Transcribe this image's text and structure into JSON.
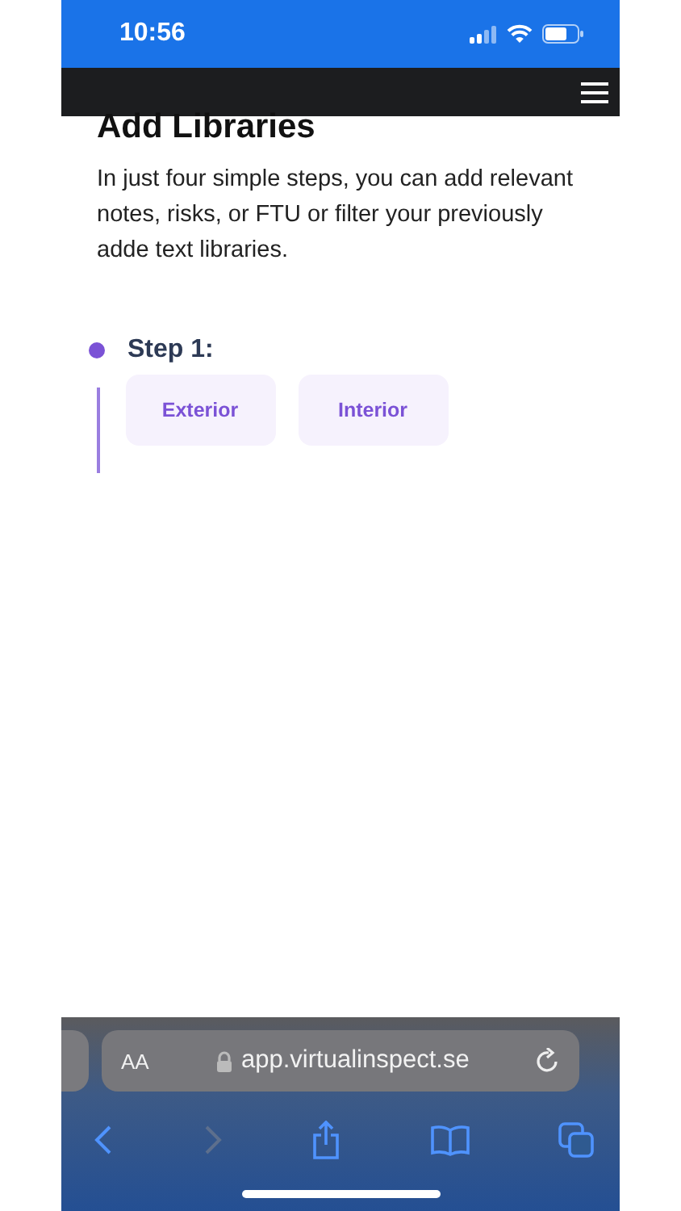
{
  "status_bar": {
    "time": "10:56"
  },
  "page": {
    "title": "Add Libraries",
    "intro": "In just four simple steps, you can add relevant notes, risks, or FTU or filter your previously adde text libraries."
  },
  "steps": [
    {
      "label": "Step 1:",
      "options": [
        "Exterior",
        "Interior"
      ]
    }
  ],
  "browser": {
    "text_size": "AA",
    "address": "app.virtualinspect.se",
    "toolbar": [
      {
        "kind": "back",
        "disabled": false
      },
      {
        "kind": "forward",
        "disabled": true
      },
      {
        "kind": "share",
        "disabled": false
      },
      {
        "kind": "bookmarks",
        "disabled": false
      },
      {
        "kind": "tabs",
        "disabled": false
      }
    ]
  }
}
